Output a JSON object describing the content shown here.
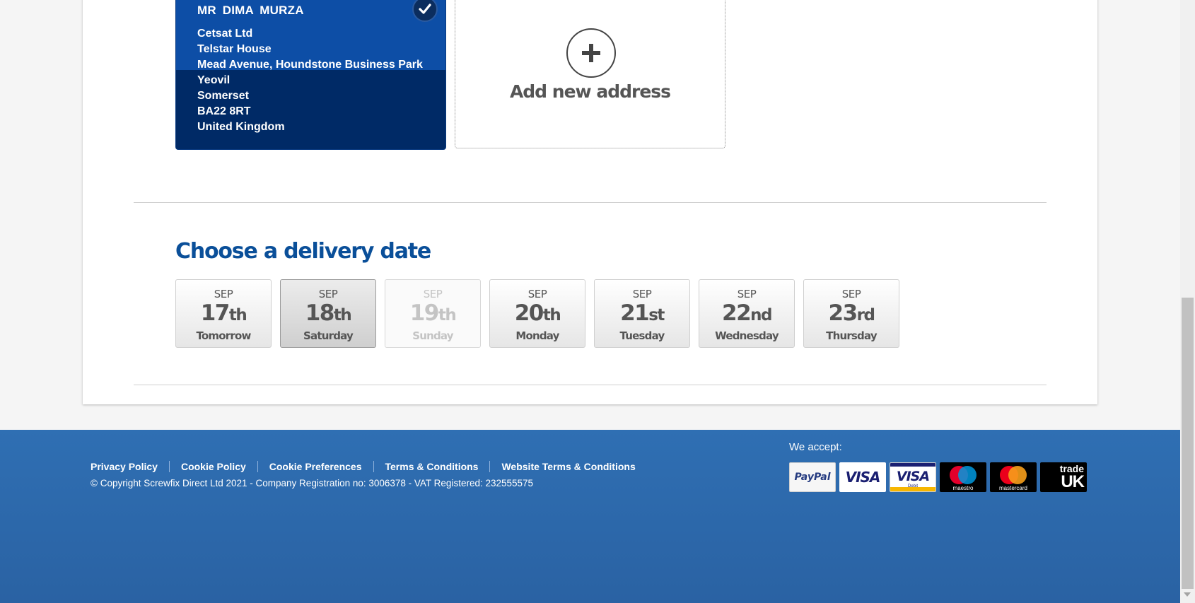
{
  "address_card": {
    "name": "MR  DIMA  MURZA",
    "lines": [
      "Cetsat Ltd",
      "Telstar House",
      "Mead Avenue, Houndstone Business Park",
      "Yeovil",
      "Somerset",
      "BA22 8RT",
      "United Kingdom"
    ],
    "selected_icon": "check-icon"
  },
  "add_address": {
    "label": "Add new address",
    "icon": "plus-icon"
  },
  "delivery": {
    "title": "Choose a delivery date",
    "dates": [
      {
        "month": "SEP",
        "day": "17",
        "suffix": "th",
        "label": "Tomorrow",
        "state": "normal"
      },
      {
        "month": "SEP",
        "day": "18",
        "suffix": "th",
        "label": "Saturday",
        "state": "selected"
      },
      {
        "month": "SEP",
        "day": "19",
        "suffix": "th",
        "label": "Sunday",
        "state": "disabled"
      },
      {
        "month": "SEP",
        "day": "20",
        "suffix": "th",
        "label": "Monday",
        "state": "normal"
      },
      {
        "month": "SEP",
        "day": "21",
        "suffix": "st",
        "label": "Tuesday",
        "state": "normal"
      },
      {
        "month": "SEP",
        "day": "22",
        "suffix": "nd",
        "label": "Wednesday",
        "state": "normal"
      },
      {
        "month": "SEP",
        "day": "23",
        "suffix": "rd",
        "label": "Thursday",
        "state": "normal"
      }
    ]
  },
  "footer": {
    "links": [
      "Privacy Policy",
      "Cookie Policy",
      "Cookie Preferences",
      "Terms & Conditions",
      "Website Terms & Conditions"
    ],
    "copyright": "© Copyright Screwfix Direct Ltd 2021 - Company Registration no: 3006378 - VAT Registered: 232555575",
    "we_accept": "We accept:",
    "payment_cards": {
      "paypal": "PayPal",
      "visa": "VISA",
      "visa_debit": "VISA",
      "visa_debit_sub": "Debit",
      "maestro": "maestro",
      "mastercard": "mastercard",
      "trade_uk_top": "trade",
      "trade_uk_bottom": "UK"
    }
  },
  "colors": {
    "brand_blue": "#0a4f99",
    "card_blue_top": "#0d4ea6",
    "card_blue_bottom": "#002a66",
    "footer_blue": "#2f6fb3"
  }
}
